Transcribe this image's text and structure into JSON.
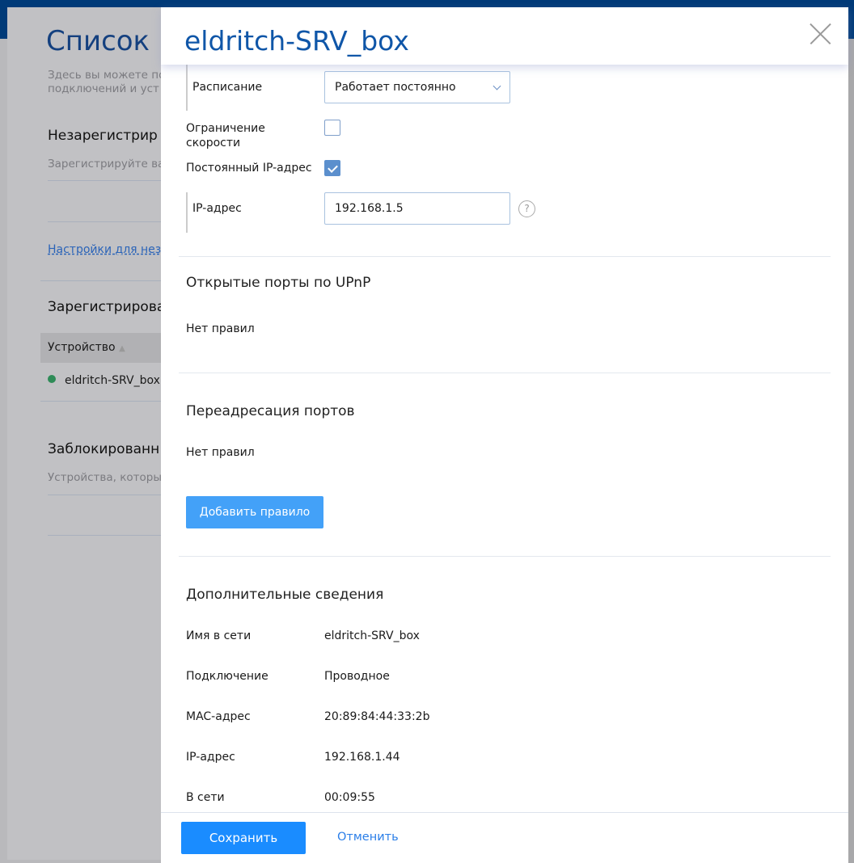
{
  "background": {
    "title": "Список",
    "desc_lines": [
      "Здесь вы можете по",
      "подключений и уст"
    ],
    "unreg_heading": "Незарегистрир",
    "unreg_sub": "Зарегистрируйте ва",
    "unreg_link": "Настройки для неза",
    "reg_heading": "Зарегистрирова",
    "col_device": "Устройство",
    "device_name": "eldritch-SRV_box",
    "blocked_heading": "Заблокированн",
    "blocked_sub": "Устройства, которы"
  },
  "modal": {
    "title": "eldritch-SRV_box",
    "schedule_label": "Расписание",
    "schedule_value": "Работает постоянно",
    "speed_limit_label_1": "Ограничение",
    "speed_limit_label_2": "скорости",
    "speed_limit_checked": false,
    "static_ip_label": "Постоянный IP-адрес",
    "static_ip_checked": true,
    "ip_label": "IP-адрес",
    "ip_value": "192.168.1.5",
    "help": "?",
    "upnp_heading": "Открытые порты по UPnP",
    "upnp_empty": "Нет правил",
    "forward_heading": "Переадресация портов",
    "forward_empty": "Нет правил",
    "add_rule": "Добавить правило",
    "info_heading": "Дополнительные сведения",
    "info": [
      {
        "label": "Имя в сети",
        "value": "eldritch-SRV_box"
      },
      {
        "label": "Подключение",
        "value": "Проводное"
      },
      {
        "label": "MAC-адрес",
        "value": "20:89:84:44:33:2b"
      },
      {
        "label": "IP-адрес",
        "value": "192.168.1.44"
      },
      {
        "label": "В сети",
        "value": "00:09:55"
      }
    ],
    "save": "Сохранить",
    "cancel": "Отменить"
  }
}
